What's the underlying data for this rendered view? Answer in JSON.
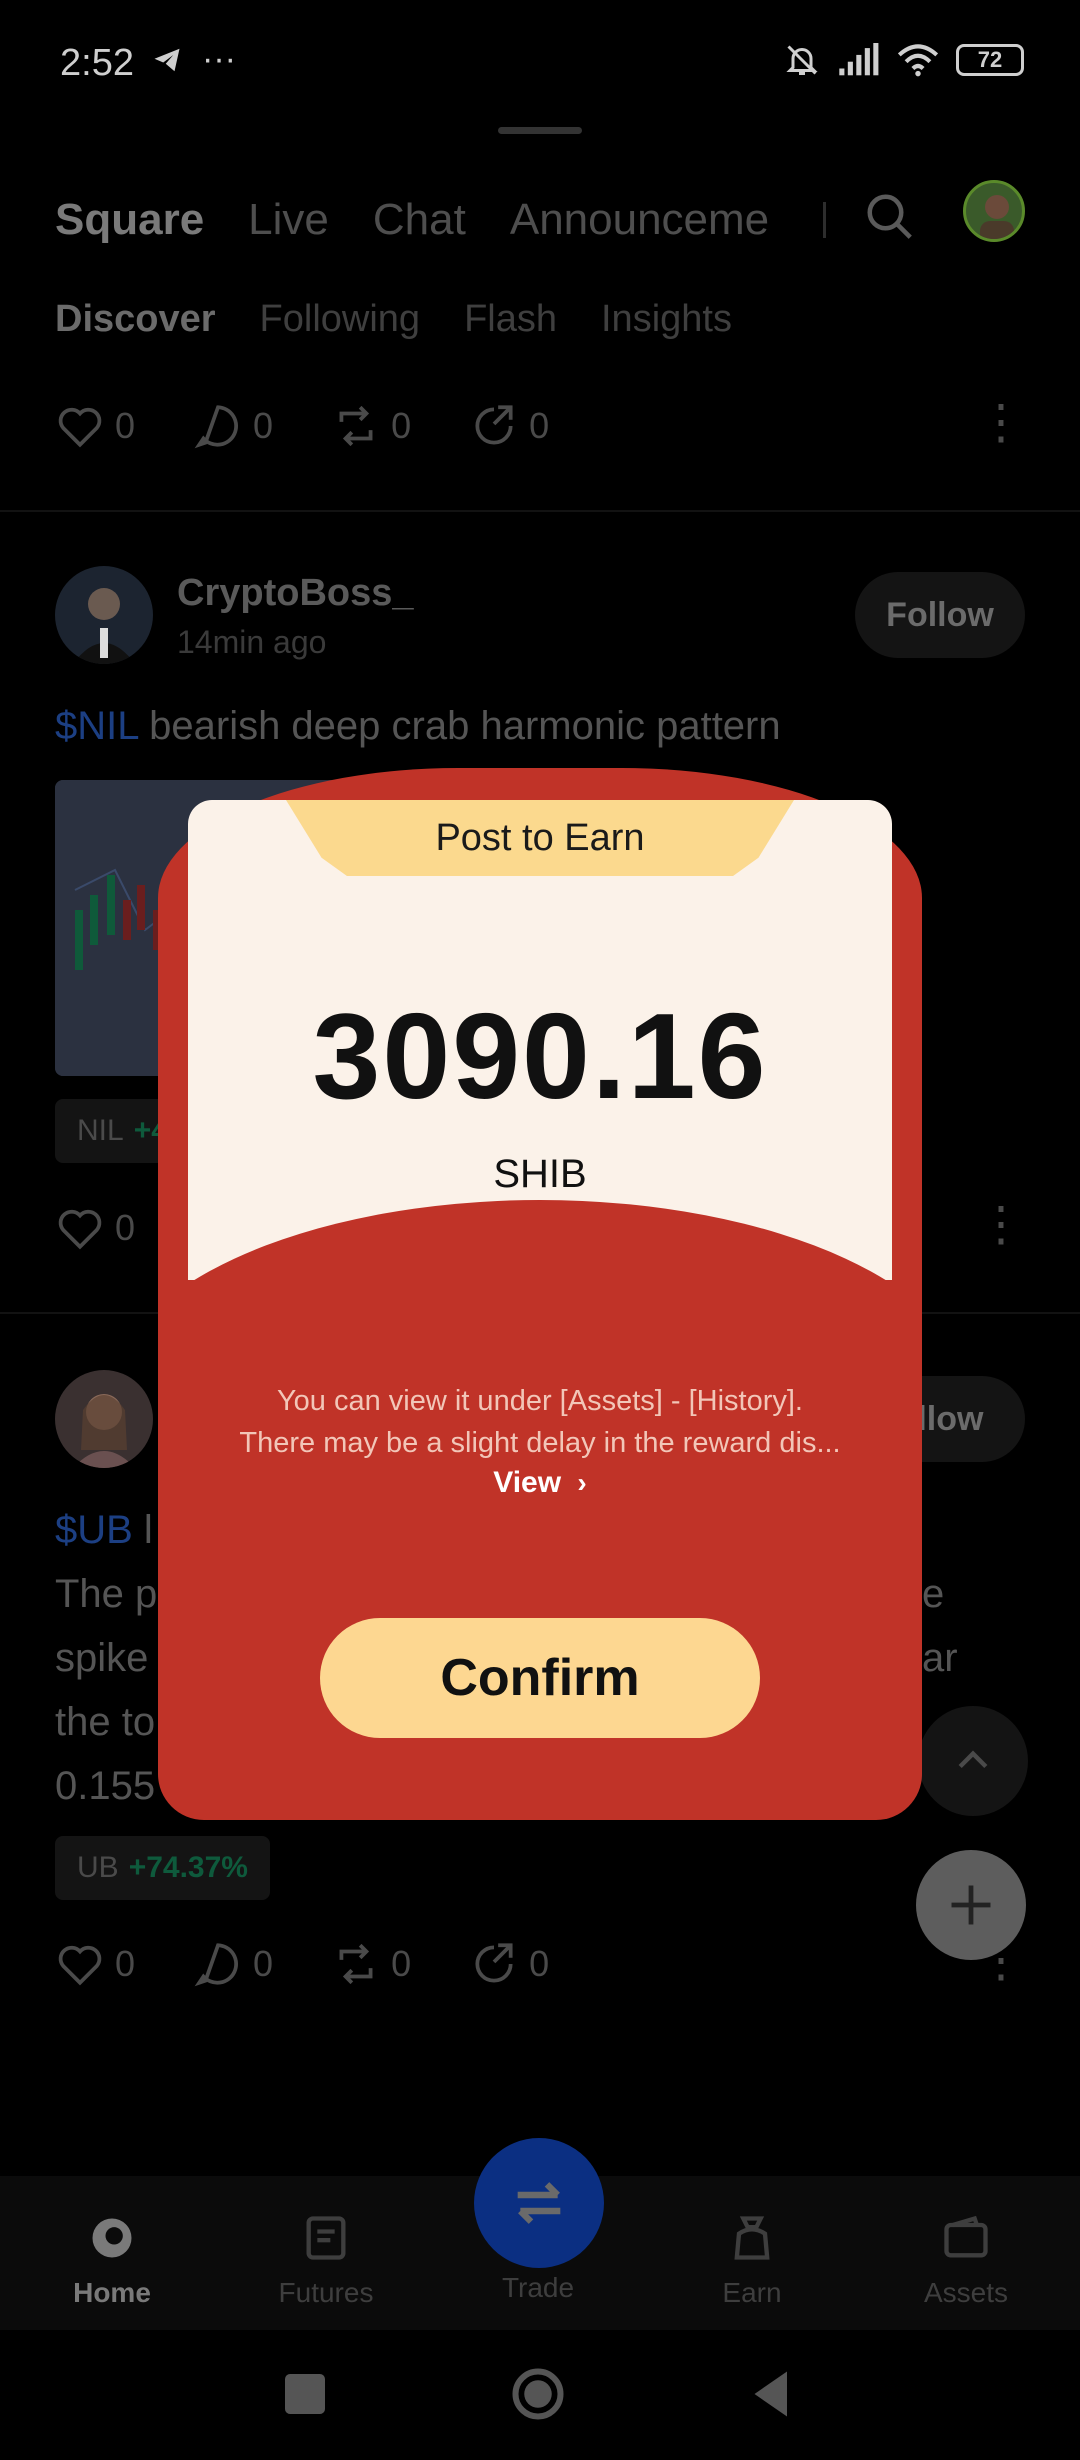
{
  "status_bar": {
    "time": "2:52",
    "battery": "72"
  },
  "top_tabs": [
    "Square",
    "Live",
    "Chat",
    "Announceme"
  ],
  "sub_tabs": [
    "Discover",
    "Following",
    "Flash",
    "Insights"
  ],
  "action_counts": {
    "like": "0",
    "comment": "0",
    "repost": "0",
    "share": "0"
  },
  "posts": [
    {
      "author": "CryptoBoss_",
      "time": "14min ago",
      "follow_label": "Follow",
      "tag": "$NIL",
      "text": " bearish deep crab harmonic pattern",
      "coin": "NIL",
      "coin_pct": "+4"
    },
    {
      "follow_label": "ollow",
      "tag": "$UB",
      "tag_suffix": " l",
      "lines": [
        "The p",
        "spike",
        "the to",
        "0.155"
      ],
      "right_fragments": [
        "e",
        "ar"
      ],
      "coin": "UB",
      "coin_pct": "+74.37%"
    }
  ],
  "bottom_nav": {
    "home": "Home",
    "futures": "Futures",
    "trade": "Trade",
    "earn": "Earn",
    "assets": "Assets"
  },
  "modal": {
    "ribbon": "Post to Earn",
    "amount": "3090.16",
    "currency": "SHIB",
    "info_line1": "You can view it under [Assets] - [History].",
    "info_line2": "There may be a slight delay in the reward dis...",
    "view_label": "View",
    "confirm_label": "Confirm"
  },
  "colors": {
    "modal_red": "#c03328",
    "card_cream": "#fbf2e9",
    "ribbon_gold": "#fbd98e",
    "confirm_gold": "#fdd791",
    "tag_blue": "#1c3f83"
  }
}
